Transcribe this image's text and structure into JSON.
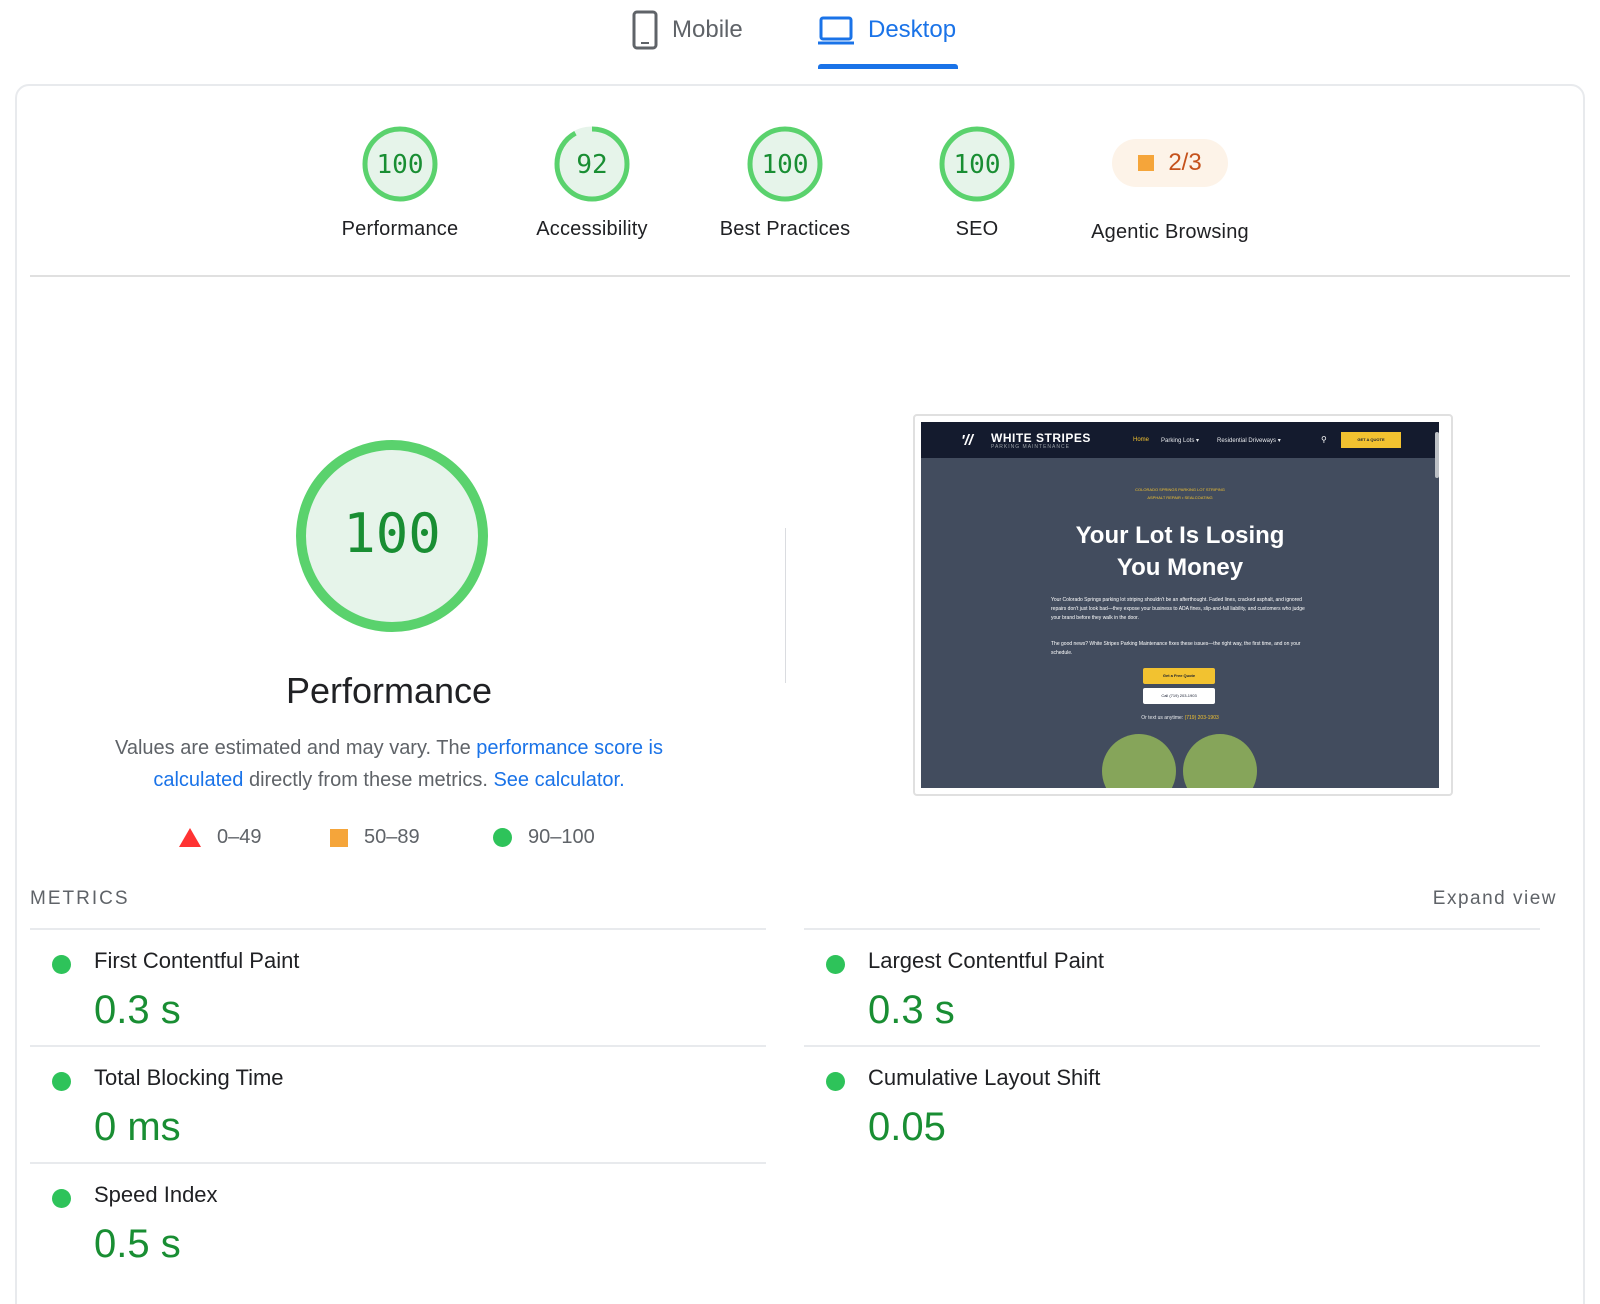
{
  "tabs": [
    {
      "label": "Mobile",
      "icon": "phone-icon",
      "active": false
    },
    {
      "label": "Desktop",
      "icon": "laptop-icon",
      "active": true
    }
  ],
  "gauges": [
    {
      "score": "100",
      "label": "Performance",
      "value": 100,
      "color": "#0cce6b"
    },
    {
      "score": "92",
      "label": "Accessibility",
      "value": 92,
      "color": "#0cce6b"
    },
    {
      "score": "100",
      "label": "Best Practices",
      "value": 100,
      "color": "#0cce6b"
    },
    {
      "score": "100",
      "label": "SEO",
      "value": 100,
      "color": "#0cce6b"
    }
  ],
  "agentic": {
    "score": "2/3",
    "label": "Agentic Browsing",
    "color": "#ffa400"
  },
  "performance": {
    "score": "100",
    "title": "Performance",
    "desc_prefix": "Values are estimated and may vary. The ",
    "link1": "performance score is calculated",
    "desc_mid": " directly from these metrics. ",
    "link2": "See calculator."
  },
  "legend": [
    {
      "range": "0–49",
      "shape": "triangle",
      "color": "#ff3333"
    },
    {
      "range": "50–89",
      "shape": "square",
      "color": "#ffa400"
    },
    {
      "range": "90–100",
      "shape": "circle",
      "color": "#0cce6b"
    }
  ],
  "screenshot": {
    "logo": "WHITE STRIPES",
    "logo_sub": "PARKING MAINTENANCE",
    "nav": [
      "Home",
      "Parking Lots ▾",
      "Residential Driveways ▾"
    ],
    "cta": "GET A QUOTE",
    "kicker": "COLORADO SPRINGS PARKING LOT STRIPING\nASPHALT REPAIR • SEALCOATING",
    "headline1": "Your Lot Is Losing",
    "headline2": "You Money",
    "body1": "Your Colorado Springs parking lot striping shouldn't be an afterthought. Faded lines, cracked asphalt, and ignored repairs don't just look bad—they expose your business to ADA fines, slip-and-fall liability, and customers who judge your brand before they walk in the door.",
    "body2": "The good news? White Stripes Parking Maintenance fixes these issues—the right way, the first time, and on your schedule.",
    "btn1": "Get a Free Quote",
    "btn2": "Call (719) 203-1903",
    "text_prefix": "Or text us anytime: ",
    "text_phone": "(719) 203-1903"
  },
  "metrics": {
    "heading": "METRICS",
    "expand": "Expand view",
    "items": [
      {
        "name": "First Contentful Paint",
        "value": "0.3 s"
      },
      {
        "name": "Largest Contentful Paint",
        "value": "0.3 s"
      },
      {
        "name": "Total Blocking Time",
        "value": "0 ms"
      },
      {
        "name": "Cumulative Layout Shift",
        "value": "0.05"
      },
      {
        "name": "Speed Index",
        "value": "0.5 s"
      }
    ]
  }
}
